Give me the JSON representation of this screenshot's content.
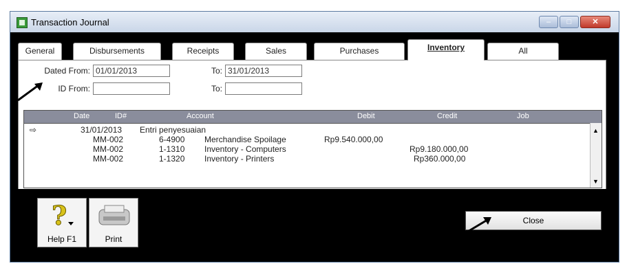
{
  "window": {
    "title": "Transaction Journal"
  },
  "tabs": [
    {
      "label": "General"
    },
    {
      "label": "Disbursements"
    },
    {
      "label": "Receipts"
    },
    {
      "label": "Sales"
    },
    {
      "label": "Purchases"
    },
    {
      "label": "Inventory",
      "active": true
    },
    {
      "label": "All"
    }
  ],
  "filters": {
    "dated_from_label": "Dated From:",
    "dated_from_value": "01/01/2013",
    "to_label": "To:",
    "dated_to_value": "31/01/2013",
    "id_from_label": "ID From:",
    "id_from_value": "",
    "id_to_label": "To:",
    "id_to_value": ""
  },
  "table": {
    "columns": [
      "Date",
      "ID#",
      "Account",
      "Debit",
      "Credit",
      "Job"
    ],
    "entry": {
      "date": "31/01/2013",
      "memo": "Entri penyesuaian"
    },
    "rows": [
      {
        "id": "MM-002",
        "account_no": "6-4900",
        "account": "Merchandise Spoilage",
        "debit": "Rp9.540.000,00",
        "credit": ""
      },
      {
        "id": "MM-002",
        "account_no": "1-1310",
        "account": "Inventory - Computers",
        "debit": "",
        "credit": "Rp9.180.000,00"
      },
      {
        "id": "MM-002",
        "account_no": "1-1320",
        "account": "Inventory - Printers",
        "debit": "",
        "credit": "Rp360.000,00"
      }
    ]
  },
  "buttons": {
    "help_label": "Help F1",
    "print_label": "Print",
    "close_label": "Close"
  }
}
